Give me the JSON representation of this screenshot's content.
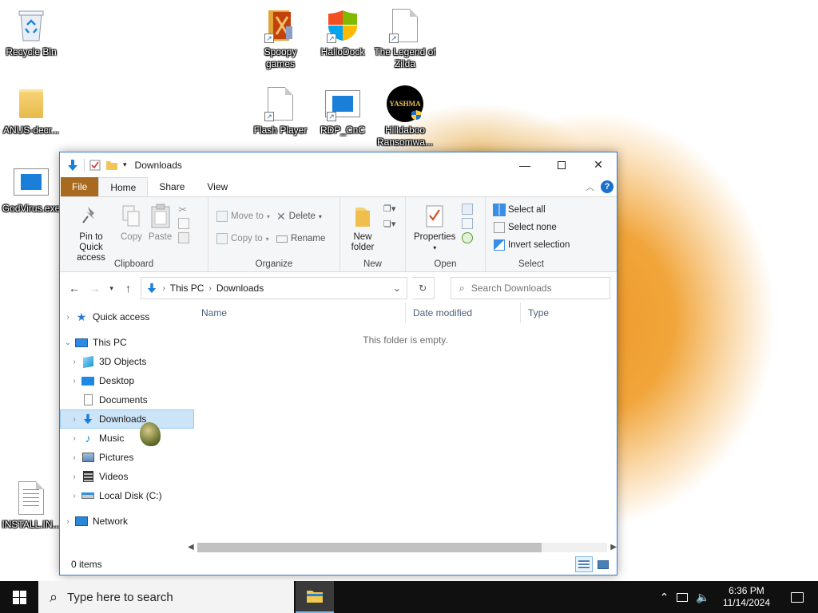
{
  "desktop": {
    "icons": {
      "recycle_bin": "Recycle Bin",
      "spoopy_games": "Spoopy games",
      "hallodock": "HalloDock",
      "legend_zilda": "The Legend of Zilda",
      "anus_decr": "ANUS-decr...",
      "flash_player": "Flash Player",
      "rdp_cnc": "RDP_CnC",
      "hilldaboo": "Hilldaboo Ransomwa...",
      "yashma_text": "YASHMA",
      "godvirus": "GodVirus.exe",
      "install": "INSTALL.IN..."
    }
  },
  "explorer": {
    "title": "Downloads",
    "tabs": {
      "file": "File",
      "home": "Home",
      "share": "Share",
      "view": "View"
    },
    "ribbon": {
      "clipboard": {
        "name": "Clipboard",
        "pin": "Pin to Quick access",
        "copy": "Copy",
        "paste": "Paste"
      },
      "organize": {
        "name": "Organize",
        "move_to": "Move to",
        "copy_to": "Copy to",
        "delete": "Delete",
        "rename": "Rename"
      },
      "new": {
        "name": "New",
        "new_folder": "New folder"
      },
      "open": {
        "name": "Open",
        "properties": "Properties"
      },
      "select": {
        "name": "Select",
        "select_all": "Select all",
        "select_none": "Select none",
        "invert": "Invert selection"
      }
    },
    "address": {
      "this_pc": "This PC",
      "downloads": "Downloads"
    },
    "search": {
      "placeholder": "Search Downloads"
    },
    "nav": {
      "quick_access": "Quick access",
      "this_pc": "This PC",
      "objects3d": "3D Objects",
      "desktop": "Desktop",
      "documents": "Documents",
      "downloads": "Downloads",
      "music": "Music",
      "pictures": "Pictures",
      "videos": "Videos",
      "local_disk": "Local Disk (C:)",
      "network": "Network"
    },
    "columns": {
      "name": "Name",
      "date_modified": "Date modified",
      "type": "Type"
    },
    "empty_message": "This folder is empty.",
    "status": "0 items"
  },
  "taskbar": {
    "search_placeholder": "Type here to search",
    "time": "6:36 PM",
    "date": "11/14/2024"
  },
  "colors": {
    "accent": "#1a6fd0",
    "file_tab": "#a86a1f",
    "selection": "#cce4f7",
    "taskbar": "#101010"
  }
}
